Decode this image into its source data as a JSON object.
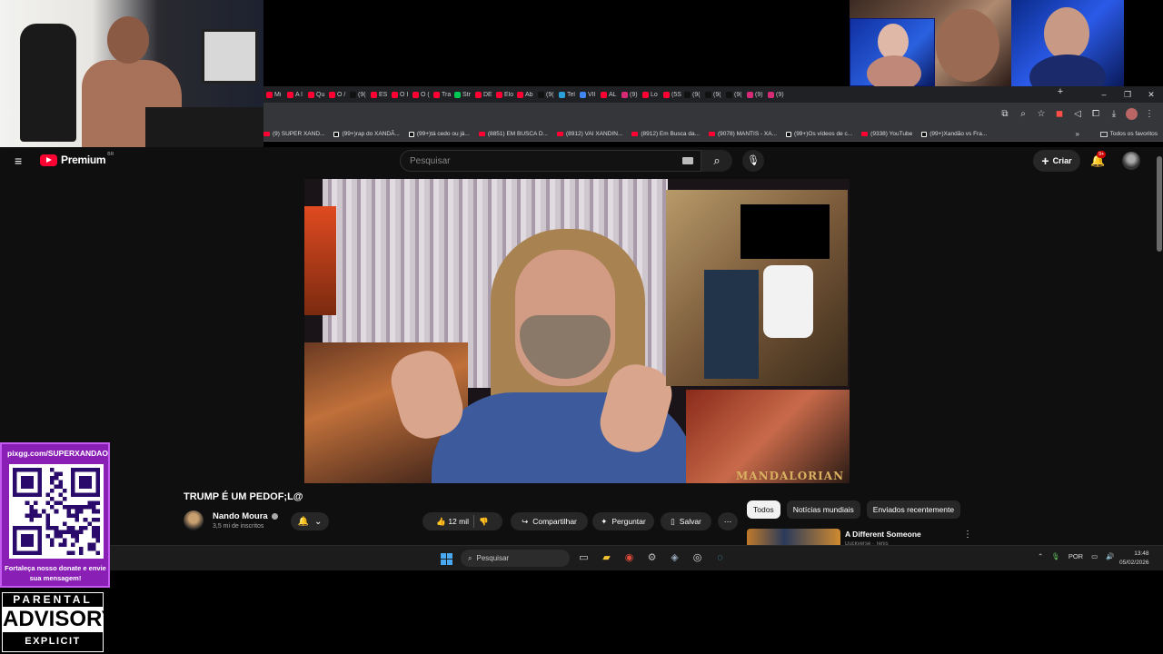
{
  "browser": {
    "tabs": [
      {
        "label": "Mi",
        "color": "#ff0033"
      },
      {
        "label": "A l",
        "color": "#ff0033"
      },
      {
        "label": "Qu",
        "color": "#ff0033"
      },
      {
        "label": "O /",
        "color": "#ff0033"
      },
      {
        "label": "(9(",
        "color": "#111111"
      },
      {
        "label": "ES",
        "color": "#ff0033"
      },
      {
        "label": "O I",
        "color": "#ff0033"
      },
      {
        "label": "O (",
        "color": "#ff0033"
      },
      {
        "label": "Tra",
        "color": "#ff0033"
      },
      {
        "label": "Str",
        "color": "#00c853"
      },
      {
        "label": "DE",
        "color": "#ff0033"
      },
      {
        "label": "Elo",
        "color": "#ff0033"
      },
      {
        "label": "Ab",
        "color": "#ff0033"
      },
      {
        "label": "(9(",
        "color": "#111111"
      },
      {
        "label": "Tel",
        "color": "#2aa1d8"
      },
      {
        "label": "VII",
        "color": "#4285f4"
      },
      {
        "label": "AL",
        "color": "#ff0033"
      },
      {
        "label": "(9)",
        "color": "#d62976"
      },
      {
        "label": "Lo",
        "color": "#ff0033"
      },
      {
        "label": "(5S",
        "color": "#ff0033"
      },
      {
        "label": "(9(",
        "color": "#111111"
      },
      {
        "label": "(9(",
        "color": "#111111"
      },
      {
        "label": "(9(",
        "color": "#111111"
      },
      {
        "label": "(9)",
        "color": "#d62976"
      },
      {
        "label": "(9)",
        "color": "#d62976"
      }
    ],
    "bookmarks": [
      {
        "label": "(9) SUPER XAND...",
        "kind": "yt"
      },
      {
        "label": "(99+)rap do XANDÃ...",
        "kind": "tk"
      },
      {
        "label": "(99+)tá cedo ou já...",
        "kind": "tk"
      },
      {
        "label": "(8851) EM BUSCA D...",
        "kind": "yt"
      },
      {
        "label": "(8912) VAI XANDIN...",
        "kind": "yt"
      },
      {
        "label": "(8912) Em Busca da...",
        "kind": "yt"
      },
      {
        "label": "(9078) MANTIS - XA...",
        "kind": "yt"
      },
      {
        "label": "(99+)Os vídeos de c...",
        "kind": "tk"
      },
      {
        "label": "(9338) YouTube",
        "kind": "yt"
      },
      {
        "label": "(99+)Xandão vs Fra...",
        "kind": "tk"
      }
    ],
    "bookmarks_more": "»",
    "all_bookmarks": "Todos os favoritos"
  },
  "youtube": {
    "brand": "Premium",
    "region": "BR",
    "search_placeholder": "Pesquisar",
    "create_label": "Criar",
    "notifications_badge": "9+",
    "video": {
      "title": "TRUMP É UM PEDOF;L@",
      "overlay_text": "MANDALORIAN",
      "channel": "Nando Moura",
      "subscribers": "3,5 mi de inscritos",
      "likes": "12 mil",
      "share_label": "Compartilhar",
      "ask_label": "Perguntar",
      "save_label": "Salvar"
    },
    "chips": [
      "Todos",
      "Notícias mundiais",
      "Enviados recentemente"
    ],
    "recommendation": {
      "title": "A Different Someone",
      "subtitle": "Duckverse · Tenis"
    }
  },
  "taskbar": {
    "search_placeholder": "Pesquisar",
    "language": "POR",
    "time": "13:48",
    "date": "05/02/2026"
  },
  "overlay": {
    "qr_url": "pixgg.com/SUPERXANDAO",
    "qr_message": "Fortaleça nosso donate e envie sua mensagem!",
    "advisory_top": "PARENTAL",
    "advisory_mid": "ADVISORY",
    "advisory_bot": "EXPLICIT CONTENT"
  }
}
